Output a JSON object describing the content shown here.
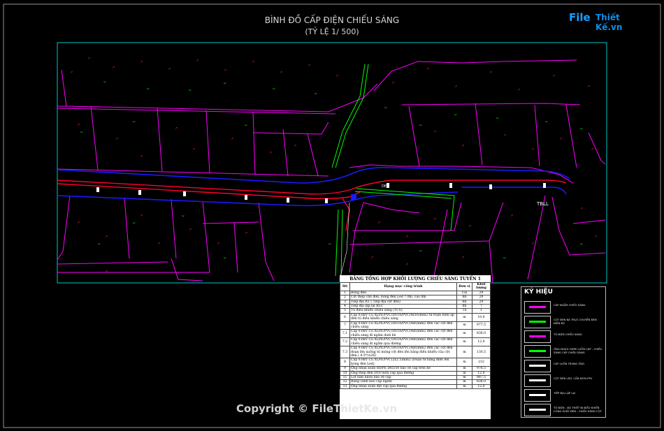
{
  "drawing": {
    "title": "BÌNH ĐỒ CẤP ĐIỆN CHIẾU SÁNG",
    "scale": "(TỶ LỆ 1/ 500)"
  },
  "logo": {
    "file": "File",
    "rest": "Thiết Kế.vn"
  },
  "labels": {
    "tbll": "TBLL",
    "de1": "DE1"
  },
  "table": {
    "title": "BẢNG TỔNG HỢP KHỐI LƯỢNG CHIẾU SÁNG TUYẾN 1",
    "headers": [
      "Stt",
      "Hạng mục công trình",
      "Đơn vị",
      "Khối lượng"
    ],
    "rows": [
      [
        "1",
        "Bóng đèn",
        "Cái",
        "29"
      ],
      [
        "2",
        "Cột thép cần đơn, bóng đèn Led 7.0m, cao 8m",
        "Bộ",
        "29"
      ],
      [
        "3",
        "Tiếp địa R1 ( Tiếp địa cột đèn)",
        "Bộ",
        "29"
      ],
      [
        "4",
        "Tiếp địa lặp lại RLC",
        "Bộ",
        "7"
      ],
      [
        "5",
        "Tủ điều khiển chiếu sáng (TCS)",
        "Tủ",
        "1"
      ],
      [
        "6",
        "Cáp 0.6kV Cu XLPE/PVC/DSTA/PVC(4x16)mm2 từ trạm biến áp đến tủ điều khiển chiếu sáng",
        "m",
        "10.0"
      ],
      [
        "7",
        "Cáp 0.6kV Cu XLPE/PVC/DSTA/PVC(4x6)mm2 đến các cột đèn chiếu sáng",
        "m",
        "977.5"
      ],
      [
        "7.1",
        "Cáp 0.6kV Cu XLPE/PVC/DSTA/PVC(4x6)mm2 đến các cột đèn chiếu sáng đi ngầm dưới hè",
        "m",
        "836.0"
      ],
      [
        "7.2",
        "Cáp 0.6kV Cu XLPE/PVC/DSTA/PVC(4x6)mm2 đến các cột đèn chiếu sáng đi ngầm qua đường",
        "m",
        "12.0"
      ],
      [
        "7.3",
        "Cáp 0.6kV Cu XLPE/PVC/DSTA/PVC(4x6)mm2 đến các cột đèn đoạn lên xuống tủ móng cột đèn lên bảng điều khiển của cột đèn ( 4.5*1x26)",
        "m",
        "130.5"
      ],
      [
        "8",
        "Cáp 0.6kV Cu XLPE/PVC(2x2.5)mm2 (Đoạn từ bảng điện lên bóng đèn Led)",
        "m",
        "232"
      ],
      [
        "9",
        "Ống nhựa xoắn HDPE D65/50 bảo vệ cáp trên hè",
        "m",
        "976.5"
      ],
      [
        "10",
        "Ống thép đen D50 luồn cáp qua đường",
        "m",
        "12.0"
      ],
      [
        "11",
        "Lót tấm nilon bảo vệ cáp",
        "m",
        "987.5"
      ],
      [
        "12",
        "Băng cảnh báo cáp ngầm",
        "m",
        "836.0"
      ],
      [
        "13",
        "Ống nhựa xoắn đặt cáp qua đường",
        "m",
        "12.0"
      ]
    ]
  },
  "legend": {
    "title": "KÝ HIỆU",
    "items": [
      {
        "label": "CÁP NGẦM CHIẾU SÁNG",
        "color": "#ff00ff"
      },
      {
        "label": "CỘT ĐÈN BA TRỤC CHUYỂN ĐÈN ĐIỆN BỘ",
        "color": "#00ff00"
      },
      {
        "label": "TỦ ĐIỆN CHIẾU SÁNG",
        "color": "#ff00ff"
      },
      {
        "label": "ỐNG NHỰA HDPE LUỒN CÁP - CHIẾU SÁNG CÁP CHIẾU SÁNG",
        "color": "#00ff00"
      },
      {
        "label": "CÁP LUỒN TRONG ỐNG",
        "color": "#ffffff"
      },
      {
        "label": "CỘT ĐÈN LED, CẦN ĐƠN PPV",
        "color": "#ffffff"
      },
      {
        "label": "TIẾP ĐỊA LẶP LẠI",
        "color": "#ffffff"
      },
      {
        "label": "TỦ ĐIỆN - BỘ THIẾT BỊ ĐIỀU KHIỂN CÔNG SUẤT ĐÈN - CHIẾU SÁNG CỘT",
        "color": "#ffffff"
      }
    ]
  },
  "watermark": "Copyright © FileThietKe.vn",
  "colors": {
    "frame": "#00c8c8",
    "parcel": "#ff00ff",
    "road_edge": "#0000ff",
    "road_center": "#ff0000",
    "green": "#00ff00",
    "text_red": "#ff2040"
  }
}
